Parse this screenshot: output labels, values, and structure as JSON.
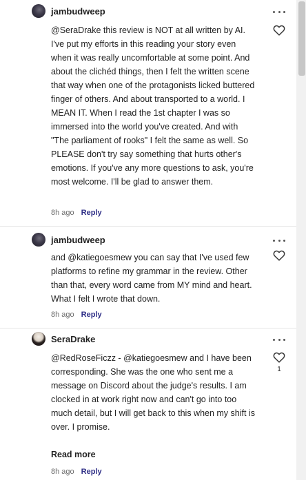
{
  "comments": [
    {
      "username": "jambudweep",
      "avatar_icon": "avatar-dark-portrait-icon",
      "text": "@SeraDrake this review is NOT at all written by AI. I've put my efforts in this reading your story even when it was really uncomfortable at some point. And about the clichéd things, then I felt the written scene that way when one of the protagonists licked buttered finger of others. And about transported to a world. I MEAN IT. When I read the 1st chapter I was so immersed into the world you've created. And with \"The parliament of rooks\" I felt the same as well. So PLEASE don't try say something that hurts other's emotions. If you've any more questions to ask, you're most welcome. I'll be glad to answer them.",
      "time": "8h ago",
      "reply_label": "Reply",
      "more_icon": "more-horizontal-icon",
      "like_icon": "heart-outline-icon"
    },
    {
      "username": "jambudweep",
      "avatar_icon": "avatar-dark-portrait-icon",
      "text": "and @katiegoesmew you can say that I've used few platforms to refine my grammar in the review. Other than that, every word came from MY mind and heart. What I felt I wrote that down.",
      "time": "8h ago",
      "reply_label": "Reply",
      "more_icon": "more-horizontal-icon",
      "like_icon": "heart-outline-icon"
    },
    {
      "username": "SeraDrake",
      "avatar_icon": "avatar-portrait-icon",
      "text": "@RedRoseFiczz - @katiegoesmew and I have been corresponding. She was the one who sent me a message on Discord about the judge's results. I am clocked in at work right now and can't go into too much detail, but I will get back to this when my shift is over. I promise.",
      "like_count": "1",
      "read_more_label": "Read more",
      "time": "8h ago",
      "reply_label": "Reply",
      "more_icon": "more-horizontal-icon",
      "like_icon": "heart-outline-icon"
    }
  ],
  "colors": {
    "reply_link": "#2f2f87",
    "meta_text": "#6b6b6b",
    "divider": "#e6e6e6"
  }
}
